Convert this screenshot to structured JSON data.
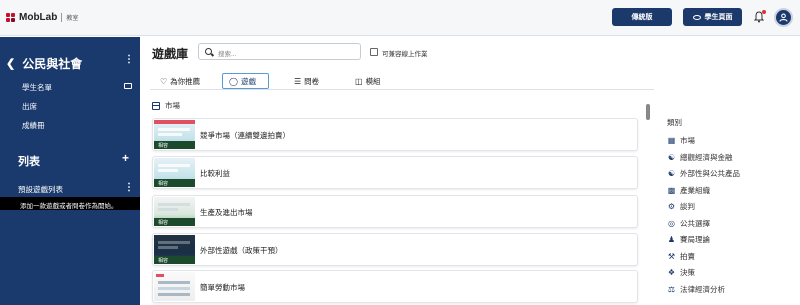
{
  "brand": {
    "name": "MobLab",
    "sub": "教室",
    "color": "#c8102e"
  },
  "header": {
    "classic_button": "傳統版",
    "student_view_button": "學生頁面",
    "accent": "#1b3a6b"
  },
  "sidebar": {
    "course": "公民與社會",
    "items": [
      {
        "label": "學生名單",
        "icon": "mail-icon"
      },
      {
        "label": "出席"
      },
      {
        "label": "成績冊"
      }
    ],
    "list_heading": "列表",
    "preset_list": "預設遊戲列表",
    "tooltip": "添加一款遊戲或者問卷作為開始。"
  },
  "main": {
    "title": "遊戲庫",
    "search_placeholder": "搜索...",
    "checkbox_label": "可兼容線上作業",
    "tabs": [
      {
        "label": "為你推薦",
        "icon": "heart-icon"
      },
      {
        "label": "遊戲",
        "icon": "gamepad-icon",
        "active": true
      },
      {
        "label": "問卷",
        "icon": "list-icon"
      },
      {
        "label": "模組",
        "icon": "module-icon"
      }
    ],
    "section": "市場",
    "cards": [
      {
        "title": "競爭市場（連續雙邊拍賣）",
        "tag": "相容"
      },
      {
        "title": "比較利益",
        "tag": "相容"
      },
      {
        "title": "生產及進出市場",
        "tag": "相容"
      },
      {
        "title": "外部性遊戲（政策干預）",
        "tag": "相容"
      },
      {
        "title": "簡單勞動市場",
        "tag": ""
      }
    ]
  },
  "categories": {
    "title": "類別",
    "items": [
      {
        "label": "市場",
        "icon": "calendar-icon"
      },
      {
        "label": "總觀經濟與金融",
        "icon": "bank-icon"
      },
      {
        "label": "外部性與公共產品",
        "icon": "people-icon"
      },
      {
        "label": "產業組織",
        "icon": "building-icon"
      },
      {
        "label": "談判",
        "icon": "handshake-icon"
      },
      {
        "label": "公共選擇",
        "icon": "vote-icon"
      },
      {
        "label": "賽局理論",
        "icon": "chess-icon"
      },
      {
        "label": "拍賣",
        "icon": "gavel-icon"
      },
      {
        "label": "決策",
        "icon": "decision-icon"
      },
      {
        "label": "法律經濟分析",
        "icon": "scale-icon"
      }
    ]
  }
}
